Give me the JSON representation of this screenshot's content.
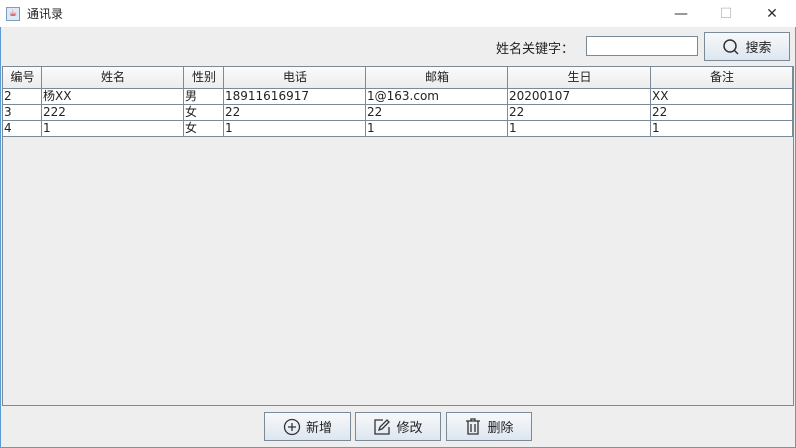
{
  "window": {
    "title": "通讯录",
    "minimize": "—",
    "maximize": "☐",
    "close": "✕"
  },
  "search": {
    "label": "姓名关键字：",
    "value": "",
    "button": "搜索"
  },
  "table": {
    "headers": [
      "编号",
      "姓名",
      "性别",
      "电话",
      "邮箱",
      "生日",
      "备注"
    ],
    "rows": [
      [
        "2",
        "杨XX",
        "男",
        "18911616917",
        "1@163.com",
        "20200107",
        "XX"
      ],
      [
        "3",
        "222",
        "女",
        "22",
        "22",
        "22",
        "22"
      ],
      [
        "4",
        "1",
        "女",
        "1",
        "1",
        "1",
        "1"
      ]
    ]
  },
  "buttons": {
    "add": "新增",
    "edit": "修改",
    "delete": "删除"
  }
}
